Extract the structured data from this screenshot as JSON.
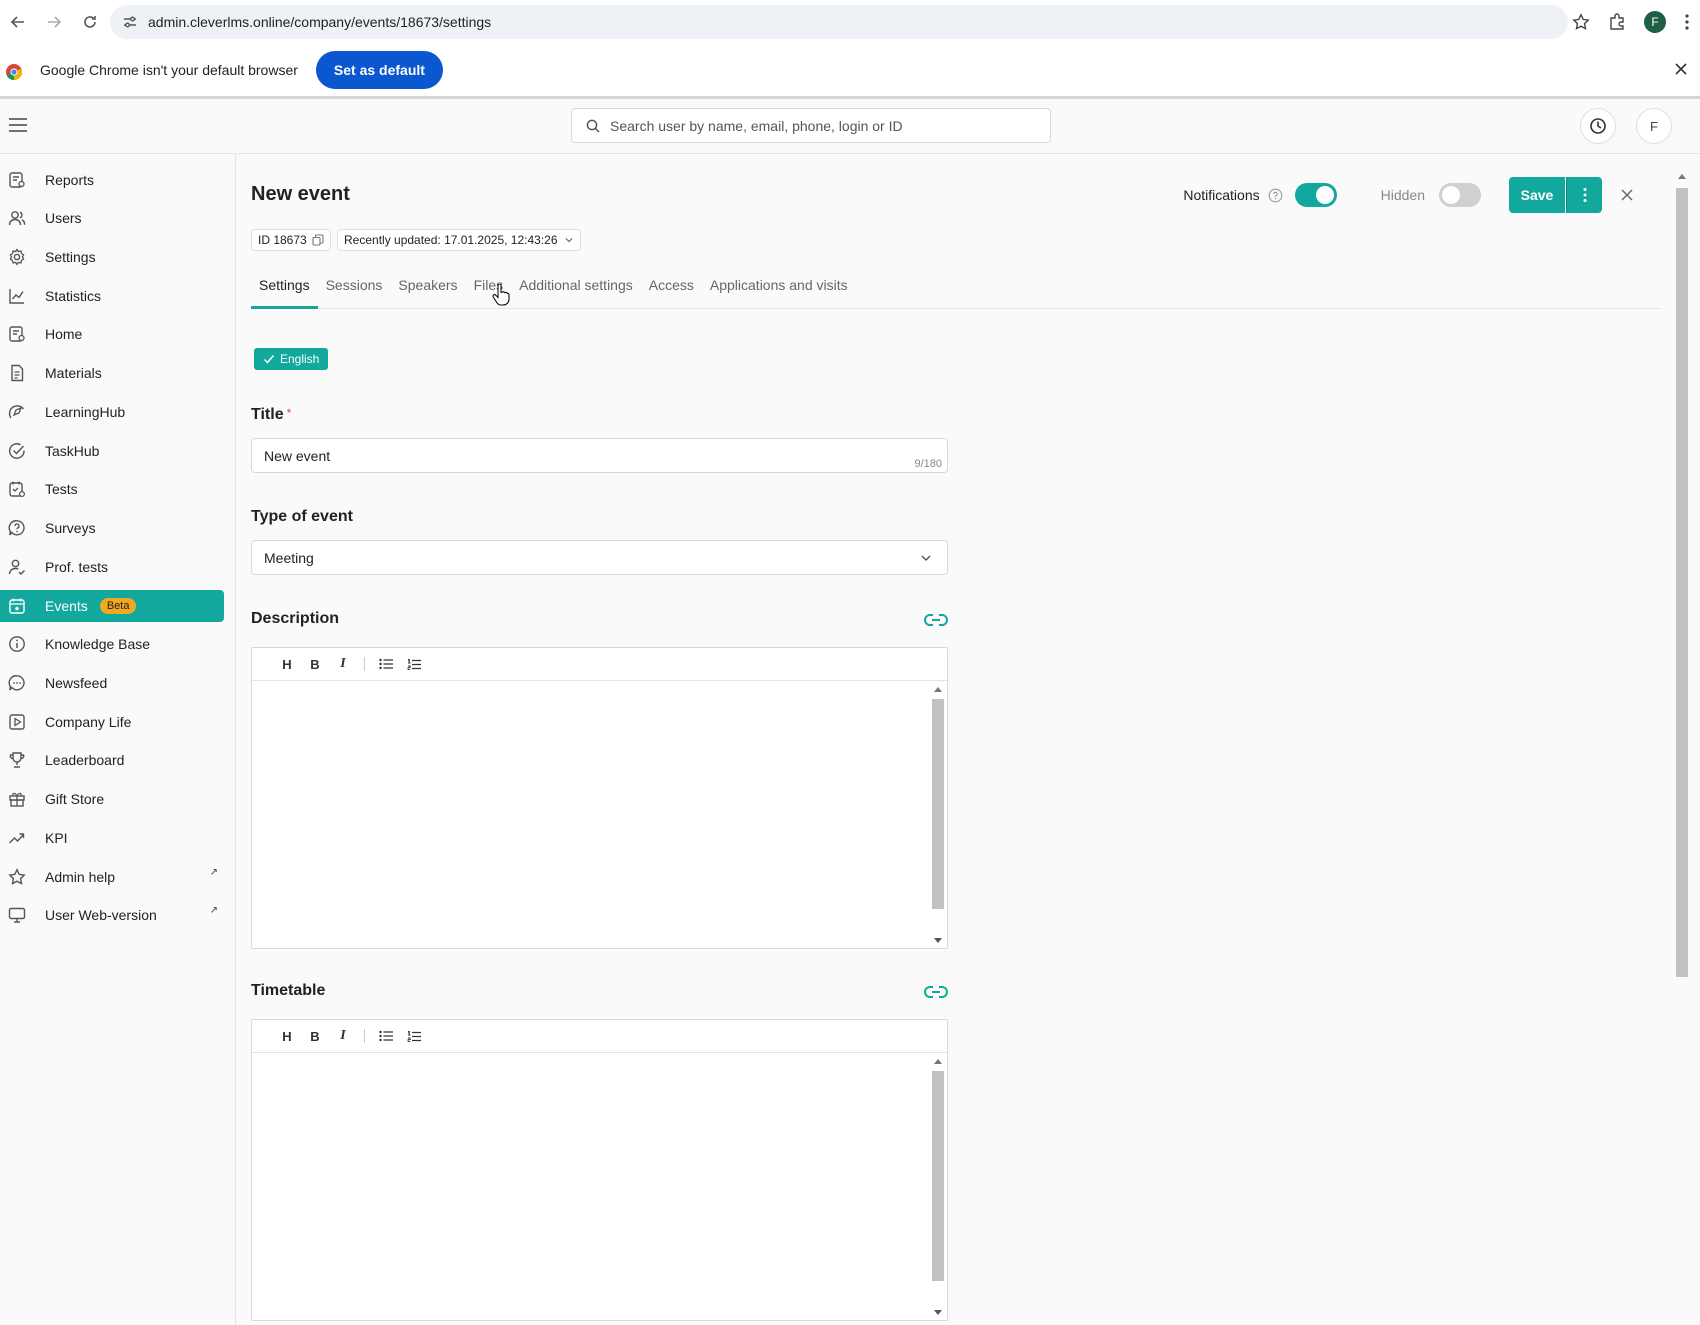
{
  "browser": {
    "url": "admin.cleverlms.online/company/events/18673/settings",
    "profile_initial": "F",
    "infobar_text": "Google Chrome isn't your default browser",
    "set_default_label": "Set as default"
  },
  "header": {
    "search_placeholder": "Search user by name, email, phone, login or ID",
    "avatar_initial": "F"
  },
  "sidebar": {
    "items": [
      {
        "label": "Reports",
        "icon": "reports-icon"
      },
      {
        "label": "Users",
        "icon": "users-icon"
      },
      {
        "label": "Settings",
        "icon": "gear-icon"
      },
      {
        "label": "Statistics",
        "icon": "chart-line-icon"
      },
      {
        "label": "Home",
        "icon": "home-icon"
      },
      {
        "label": "Materials",
        "icon": "document-icon"
      },
      {
        "label": "LearningHub",
        "icon": "compass-icon"
      },
      {
        "label": "TaskHub",
        "icon": "check-circle-icon"
      },
      {
        "label": "Tests",
        "icon": "tests-icon"
      },
      {
        "label": "Surveys",
        "icon": "question-bubble-icon"
      },
      {
        "label": "Prof. tests",
        "icon": "person-check-icon"
      },
      {
        "label": "Events",
        "icon": "calendar-icon",
        "badge": "Beta",
        "active": true
      },
      {
        "label": "Knowledge Base",
        "icon": "info-icon"
      },
      {
        "label": "Newsfeed",
        "icon": "chat-icon"
      },
      {
        "label": "Company Life",
        "icon": "play-icon"
      },
      {
        "label": "Leaderboard",
        "icon": "trophy-icon"
      },
      {
        "label": "Gift Store",
        "icon": "gift-icon"
      },
      {
        "label": "KPI",
        "icon": "trend-icon"
      },
      {
        "label": "Admin help",
        "icon": "star-icon",
        "external": true
      },
      {
        "label": "User Web-version",
        "icon": "monitor-icon",
        "external": true
      }
    ]
  },
  "page": {
    "title": "New event",
    "id_label": "ID 18673",
    "updated_label": "Recently updated: 17.01.2025, 12:43:26",
    "notifications_label": "Notifications",
    "notifications_on": true,
    "hidden_label": "Hidden",
    "hidden_on": false,
    "save_label": "Save",
    "tabs": [
      "Settings",
      "Sessions",
      "Speakers",
      "Files",
      "Additional settings",
      "Access",
      "Applications and visits"
    ],
    "active_tab": "Settings",
    "language": "English"
  },
  "form": {
    "title_label": "Title",
    "title_value": "New event",
    "title_counter": "9/180",
    "type_label": "Type of event",
    "type_value": "Meeting",
    "description_label": "Description",
    "timetable_label": "Timetable",
    "toolbar": {
      "heading": "H",
      "bold": "B",
      "italic": "I"
    }
  },
  "colors": {
    "accent": "#12a89d",
    "badge": "#f2a922",
    "chrome_button": "#0b57d0"
  }
}
